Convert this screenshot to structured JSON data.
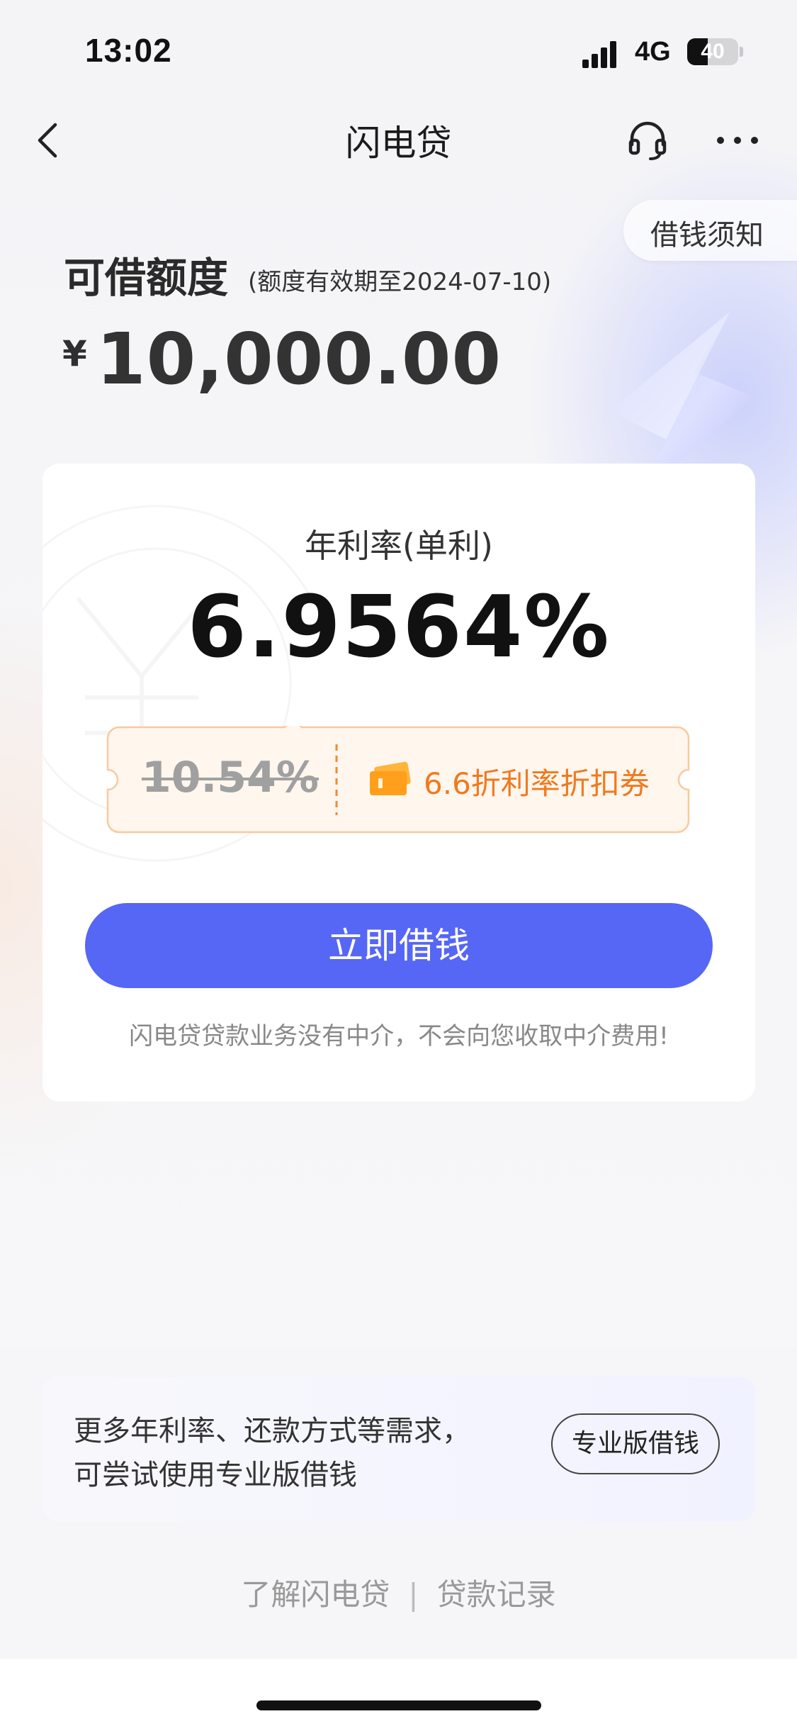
{
  "status_bar": {
    "time": "13:02",
    "network": "4G",
    "battery_text": "40",
    "battery_level": 0.4
  },
  "nav": {
    "title": "闪电贷",
    "back_icon": "chevron-left-icon",
    "support_icon": "headset-icon",
    "more_icon": "more-dots-icon"
  },
  "notice": {
    "label": "借钱须知"
  },
  "credit": {
    "label": "可借额度",
    "expiry": "(额度有效期至2024-07-10)",
    "currency": "¥",
    "amount": "10,000.00"
  },
  "rate": {
    "label": "年利率(单利)",
    "value": "6.9564%",
    "original": "10.54%",
    "coupon_text": "6.6折利率折扣券",
    "coupon_icon": "ticket-icon"
  },
  "actions": {
    "borrow": "立即借钱"
  },
  "disclaimer": "闪电贷贷款业务没有中介，不会向您收取中介费用!",
  "pro": {
    "line1": "更多年利率、还款方式等需求，",
    "line2": "可尝试使用专业版借钱",
    "button": "专业版借钱"
  },
  "footer": {
    "about": "了解闪电贷",
    "separator": "|",
    "records": "贷款记录"
  },
  "colors": {
    "accent": "#5666f5",
    "coupon_orange": "#f07a1e",
    "coupon_bg": "#fff6ee"
  }
}
